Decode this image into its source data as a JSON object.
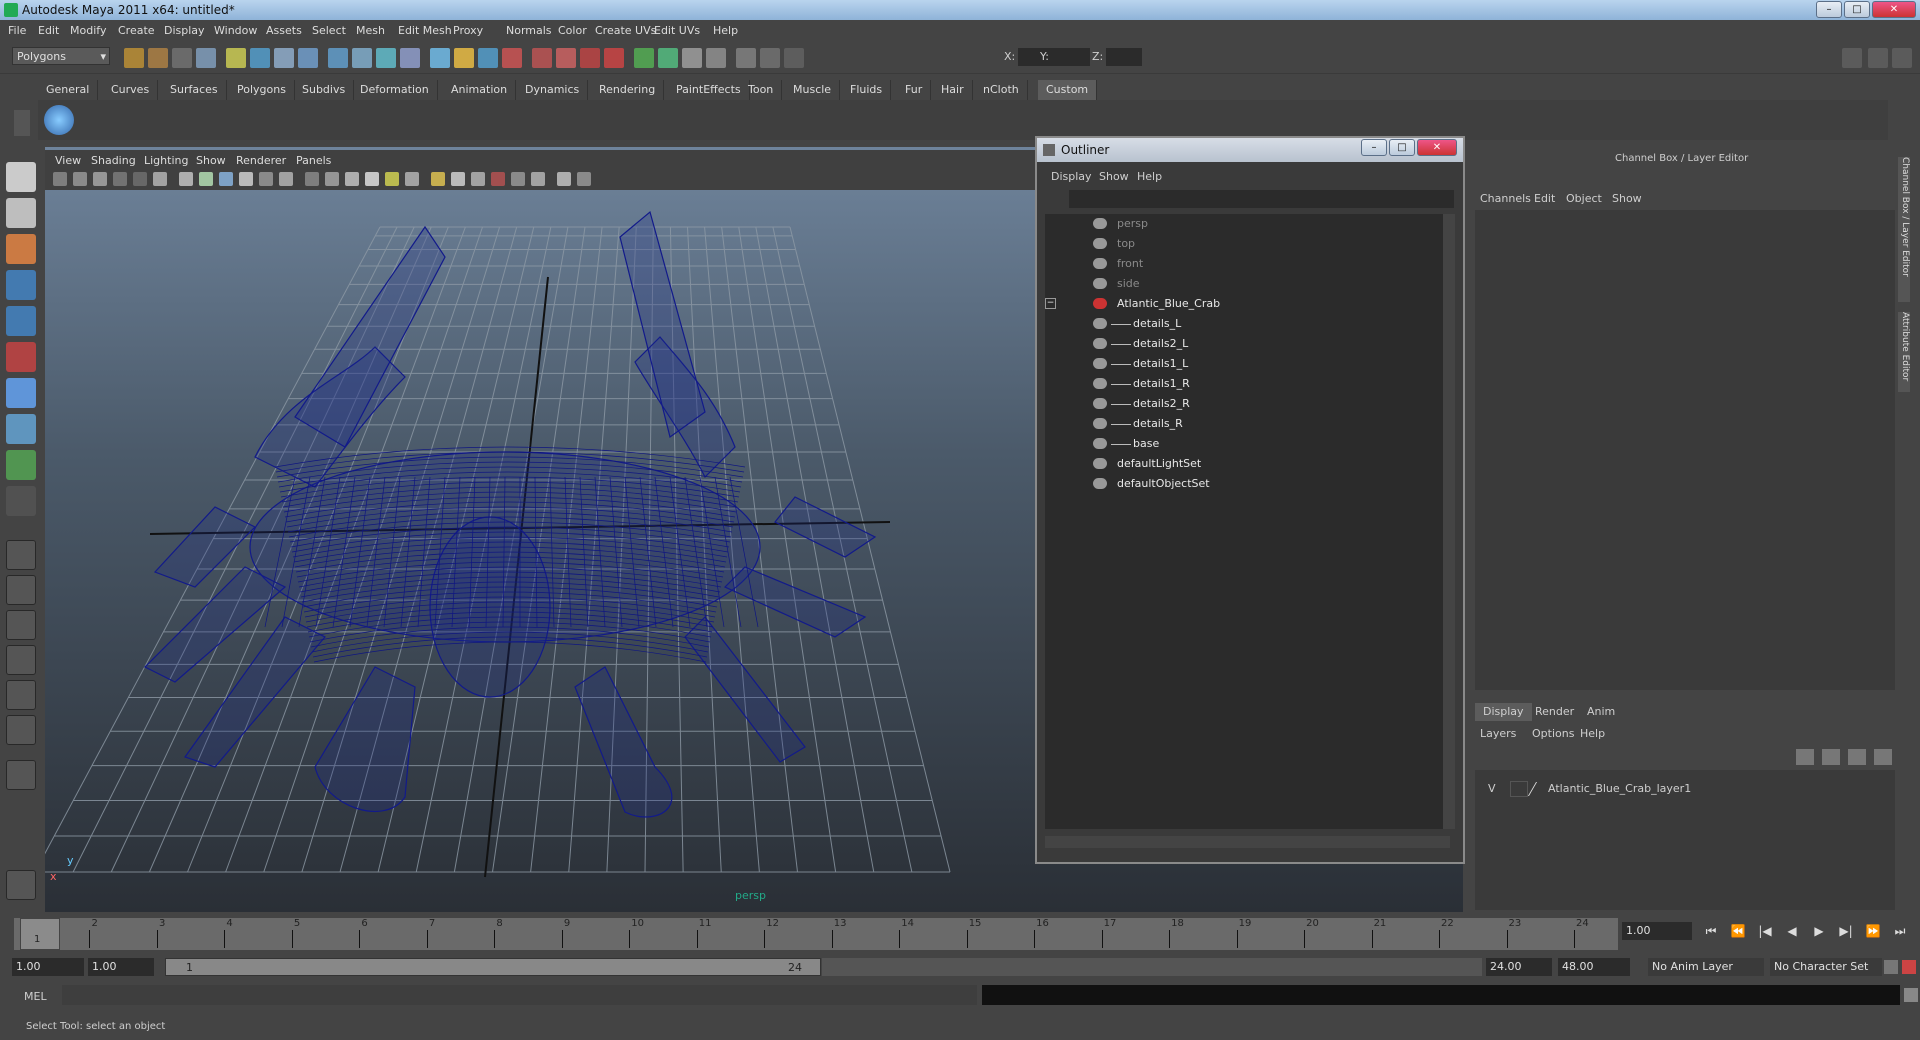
{
  "app": {
    "title": "Autodesk Maya 2011 x64: untitled*",
    "colors": {
      "title_bg": "#9fbfe0",
      "ui_bg": "#444444",
      "viewport_top": "#6f849c",
      "viewport_bottom": "#2a2f36",
      "wire": "#1a1f7a"
    }
  },
  "menubar": [
    "File",
    "Edit",
    "Modify",
    "Create",
    "Display",
    "Window",
    "Assets",
    "Select",
    "Mesh",
    "Edit Mesh",
    "Proxy",
    "Normals",
    "Color",
    "Create UVs",
    "Edit UVs",
    "Help"
  ],
  "toolbar": {
    "mode_select": "Polygons",
    "coord_labels": [
      "X:",
      "Y:",
      "Z:"
    ]
  },
  "shelf_tabs": [
    "General",
    "Curves",
    "Surfaces",
    "Polygons",
    "Subdivs",
    "Deformation",
    "Animation",
    "Dynamics",
    "Rendering",
    "PaintEffects",
    "Toon",
    "Muscle",
    "Fluids",
    "Fur",
    "Hair",
    "nCloth",
    "Custom"
  ],
  "shelf_active": "Custom",
  "viewport": {
    "menu": [
      "View",
      "Shading",
      "Lighting",
      "Show",
      "Renderer",
      "Panels"
    ],
    "camera_label": "persp",
    "axis_y": "y",
    "axis_x": "x"
  },
  "outliner": {
    "title": "Outliner",
    "menu": [
      "Display",
      "Show",
      "Help"
    ],
    "items": [
      {
        "label": "persp",
        "dim": true,
        "indent": 0,
        "icon": "camera-icon"
      },
      {
        "label": "top",
        "dim": true,
        "indent": 0,
        "icon": "camera-icon"
      },
      {
        "label": "front",
        "dim": true,
        "indent": 0,
        "icon": "camera-icon"
      },
      {
        "label": "side",
        "dim": true,
        "indent": 0,
        "icon": "camera-icon"
      },
      {
        "label": "Atlantic_Blue_Crab",
        "dim": false,
        "indent": 0,
        "icon": "group-icon",
        "expanded": true
      },
      {
        "label": "details_L",
        "dim": false,
        "indent": 1,
        "icon": "mesh-icon"
      },
      {
        "label": "details2_L",
        "dim": false,
        "indent": 1,
        "icon": "mesh-icon"
      },
      {
        "label": "details1_L",
        "dim": false,
        "indent": 1,
        "icon": "mesh-icon"
      },
      {
        "label": "details1_R",
        "dim": false,
        "indent": 1,
        "icon": "mesh-icon"
      },
      {
        "label": "details2_R",
        "dim": false,
        "indent": 1,
        "icon": "mesh-icon"
      },
      {
        "label": "details_R",
        "dim": false,
        "indent": 1,
        "icon": "mesh-icon"
      },
      {
        "label": "base",
        "dim": false,
        "indent": 1,
        "icon": "mesh-icon"
      },
      {
        "label": "defaultLightSet",
        "dim": false,
        "indent": 0,
        "icon": "set-icon"
      },
      {
        "label": "defaultObjectSet",
        "dim": false,
        "indent": 0,
        "icon": "set-icon"
      }
    ]
  },
  "channelbox": {
    "title": "Channel Box / Layer Editor",
    "menu": [
      "Channels",
      "Edit",
      "Object",
      "Show"
    ],
    "side_tabs": [
      "Channel Box / Layer Editor",
      "Attribute Editor"
    ]
  },
  "layer_editor": {
    "tabs": [
      "Display",
      "Render",
      "Anim"
    ],
    "active_tab": "Display",
    "menu": [
      "Layers",
      "Options",
      "Help"
    ],
    "layers": [
      {
        "visible": "V",
        "name": "Atlantic_Blue_Crab_layer1"
      }
    ]
  },
  "timeline": {
    "ticks": [
      "1",
      "2",
      "3",
      "4",
      "5",
      "6",
      "7",
      "8",
      "9",
      "10",
      "11",
      "12",
      "13",
      "14",
      "15",
      "16",
      "17",
      "18",
      "19",
      "20",
      "21",
      "22",
      "23",
      "24"
    ],
    "current_frame_marker": "1",
    "current_time": "1.00"
  },
  "range": {
    "start_anim": "1.00",
    "start": "1.00",
    "range_left": "1",
    "range_right": "24",
    "end": "24.00",
    "end_anim": "48.00",
    "anim_layer": "No Anim Layer",
    "char_set": "No Character Set"
  },
  "cmdline": {
    "label": "MEL"
  },
  "helpline": {
    "text": "Select Tool: select an object"
  }
}
